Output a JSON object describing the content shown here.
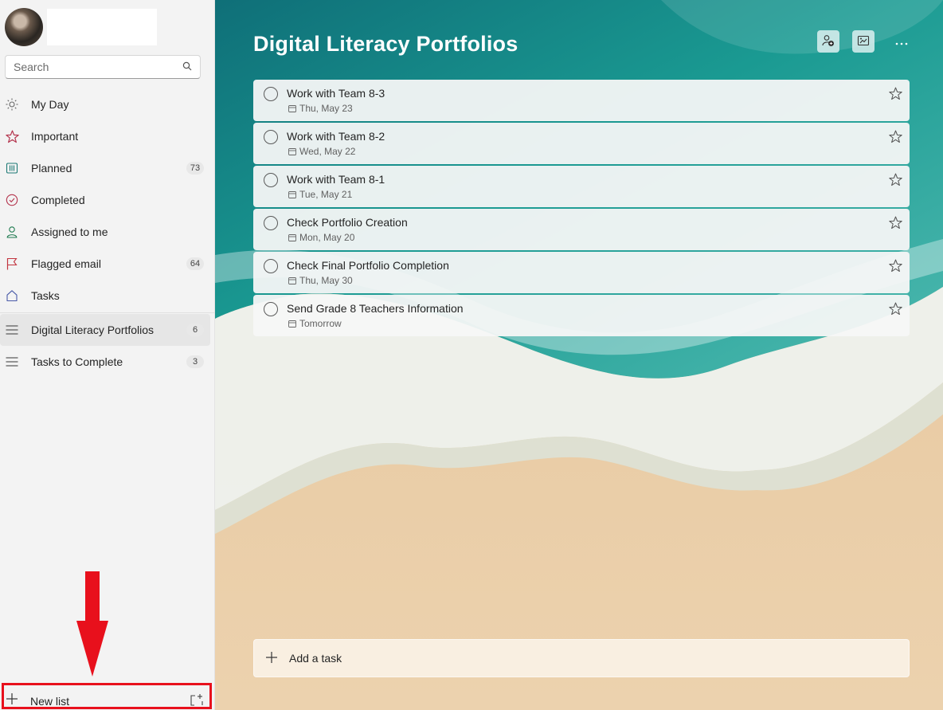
{
  "sidebar": {
    "search_placeholder": "Search",
    "nav": [
      {
        "label": "My Day",
        "icon": "sun-icon",
        "count": ""
      },
      {
        "label": "Important",
        "icon": "star-icon",
        "count": ""
      },
      {
        "label": "Planned",
        "icon": "calendar-grid-icon",
        "count": "73"
      },
      {
        "label": "Completed",
        "icon": "check-circle-icon",
        "count": ""
      },
      {
        "label": "Assigned to me",
        "icon": "person-icon",
        "count": ""
      },
      {
        "label": "Flagged email",
        "icon": "flag-icon",
        "count": "64"
      },
      {
        "label": "Tasks",
        "icon": "home-icon",
        "count": ""
      }
    ],
    "lists": [
      {
        "label": "Digital Literacy Portfolios",
        "count": "6",
        "active": true
      },
      {
        "label": "Tasks to Complete",
        "count": "3",
        "active": false
      }
    ],
    "new_list_label": "New list"
  },
  "main": {
    "title": "Digital Literacy Portfolios",
    "tasks": [
      {
        "title": "Work with Team 8-3",
        "due": "Thu, May 23"
      },
      {
        "title": "Work with Team 8-2",
        "due": "Wed, May 22"
      },
      {
        "title": "Work with Team 8-1",
        "due": "Tue, May 21"
      },
      {
        "title": "Check Portfolio Creation",
        "due": "Mon, May 20"
      },
      {
        "title": "Check Final Portfolio Completion",
        "due": "Thu, May 30"
      },
      {
        "title": "Send Grade 8 Teachers Information",
        "due": "Tomorrow"
      }
    ],
    "add_task_label": "Add a task"
  },
  "colors": {
    "accent_red": "#e8101c",
    "sea": "#1a8f8a",
    "sand": "#e7c9a2"
  }
}
